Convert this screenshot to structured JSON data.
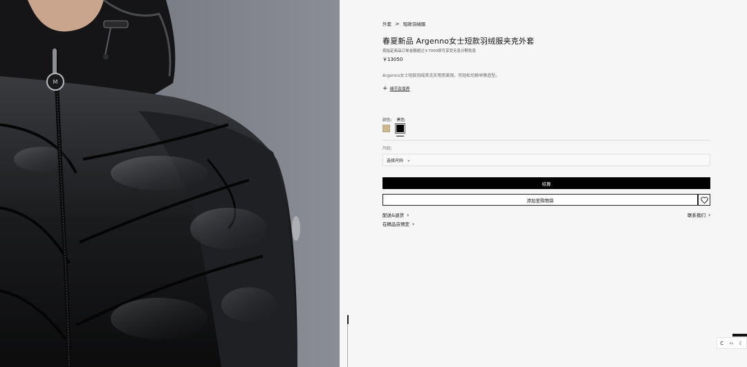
{
  "breadcrumb": {
    "items": [
      "外套",
      "短款羽绒服"
    ],
    "separator": ">"
  },
  "product": {
    "title": "春夏新品 Argenno女士短款羽绒服夹克外套",
    "promo": "按指定商品订单金额超过￥7000即可享受无息分期免息",
    "price": "￥13050",
    "description": "Argenno女士短款羽绒夹克实用而美观，可轻松切换早晚造型。",
    "details_link": "细节及保养"
  },
  "color": {
    "label": "颜色:",
    "selected": "黑色",
    "swatches": [
      {
        "name": "beige-swatch",
        "hex": "#cdb892"
      },
      {
        "name": "black-swatch",
        "hex": "#050505"
      }
    ]
  },
  "size": {
    "label": "尺码:",
    "placeholder": "选择尺码"
  },
  "actions": {
    "checkout": "结算",
    "add_to_cart": "添加至购物袋",
    "wishlist_icon": "heart-icon"
  },
  "links": {
    "shipping": "配送&退货",
    "contact": "联系我们",
    "boutique": "在精品店预定"
  },
  "widget": {
    "icons": [
      "C",
      "‹›",
      "moon-icon"
    ]
  },
  "colors": {
    "accent": "#000000",
    "panel_bg": "#f6f6f6"
  }
}
